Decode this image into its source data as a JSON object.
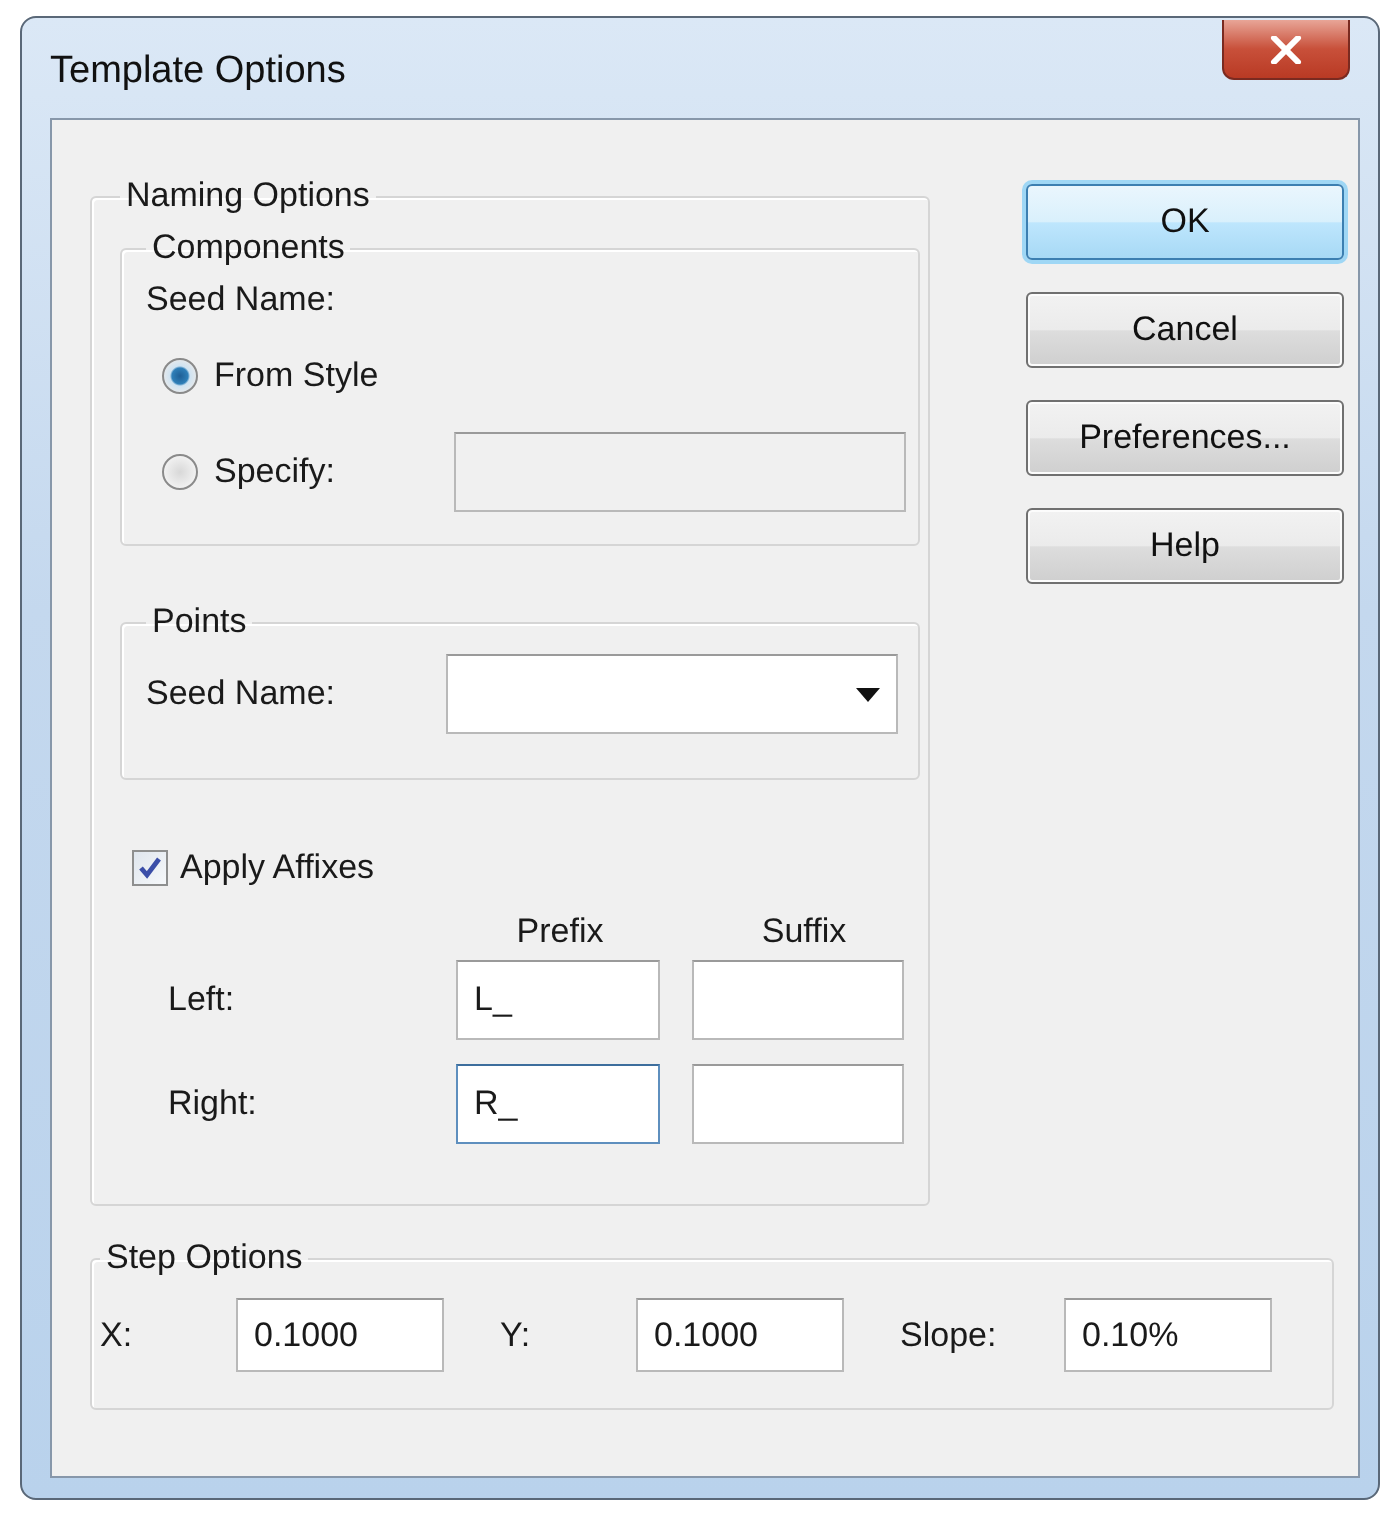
{
  "window": {
    "title": "Template Options"
  },
  "naming_options": {
    "title": "Naming Options",
    "components": {
      "title": "Components",
      "seed_name_label": "Seed Name:",
      "options": [
        {
          "label": "From Style",
          "selected": true,
          "kind": "plain"
        },
        {
          "label": "Specify:",
          "selected": false,
          "kind": "field"
        }
      ]
    },
    "points": {
      "title": "Points",
      "seed_name_label": "Seed Name:"
    },
    "apply_affixes": {
      "label": "Apply Affixes",
      "checked": true
    },
    "affix_headers": [
      "Prefix",
      "Suffix"
    ],
    "affix_rows": [
      {
        "label": "Left:",
        "prefix": "L_",
        "focused": false
      },
      {
        "label": "Right:",
        "prefix": "R_",
        "focused": true
      }
    ]
  },
  "step_options": {
    "title": "Step Options",
    "fields": [
      {
        "label": "X:",
        "value": "0.1000"
      },
      {
        "label": "Y:",
        "value": "0.1000"
      },
      {
        "label": "Slope:",
        "value": "0.10%"
      }
    ]
  },
  "buttons": [
    {
      "label": "OK",
      "default": true
    },
    {
      "label": "Cancel",
      "default": false
    },
    {
      "label": "Preferences...",
      "default": false
    },
    {
      "label": "Help",
      "default": false
    }
  ]
}
